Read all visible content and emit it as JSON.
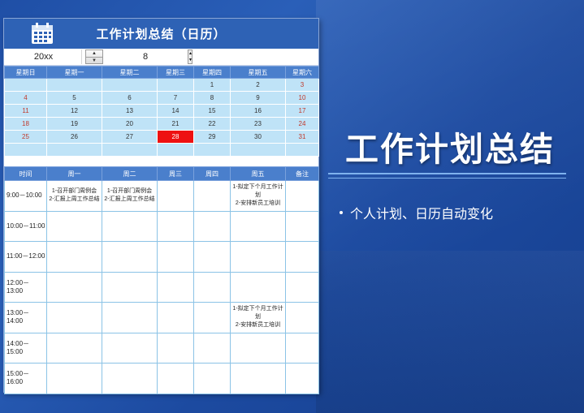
{
  "sheet": {
    "title": "工作计划总结（日历）",
    "year_value": "20xx",
    "month_value": "8"
  },
  "calendar": {
    "weekdays": [
      "星期日",
      "星期一",
      "星期二",
      "星期三",
      "星期四",
      "星期五",
      "星期六"
    ],
    "weeks": [
      [
        "",
        "",
        "",
        "",
        "1",
        "2",
        "3"
      ],
      [
        "4",
        "5",
        "6",
        "7",
        "8",
        "9",
        "10"
      ],
      [
        "11",
        "12",
        "13",
        "14",
        "15",
        "16",
        "17"
      ],
      [
        "18",
        "19",
        "20",
        "21",
        "22",
        "23",
        "24"
      ],
      [
        "25",
        "26",
        "27",
        "28",
        "29",
        "30",
        "31"
      ],
      [
        "",
        "",
        "",
        "",
        "",
        "",
        ""
      ]
    ],
    "highlight_day": "28",
    "highlight_color": "#ee1111"
  },
  "schedule": {
    "headers": [
      "时间",
      "周一",
      "周二",
      "周三",
      "周四",
      "周五",
      "备注"
    ],
    "rows": [
      {
        "time": "9:00－10:00",
        "cells": [
          "1-召开部门周例会\n2-汇报上周工作总结",
          "1-召开部门周例会\n2-汇报上周工作总结",
          "",
          "",
          "1-拟定下个月工作计划\n2-安排新员工培训",
          ""
        ]
      },
      {
        "time": "10:00－11:00",
        "cells": [
          "",
          "",
          "",
          "",
          "",
          ""
        ]
      },
      {
        "time": "11:00－12:00",
        "cells": [
          "",
          "",
          "",
          "",
          "",
          ""
        ]
      },
      {
        "time": "12:00－13:00",
        "cells": [
          "",
          "",
          "",
          "",
          "",
          ""
        ]
      },
      {
        "time": "13:00－14:00",
        "cells": [
          "",
          "",
          "",
          "",
          "1-拟定下个月工作计划\n2-安排新员工培训",
          ""
        ]
      },
      {
        "time": "14:00－15:00",
        "cells": [
          "",
          "",
          "",
          "",
          "",
          ""
        ]
      },
      {
        "time": "15:00－16:00",
        "cells": [
          "",
          "",
          "",
          "",
          "",
          ""
        ]
      }
    ]
  },
  "headline": "工作计划总结",
  "bullet": "个人计划、日历自动变化",
  "colors": {
    "header_blue": "#4a7fcc",
    "title_blue": "#2e62b5",
    "calendar_cell": "#bfe3f7",
    "weekend_red": "#c0392b"
  }
}
